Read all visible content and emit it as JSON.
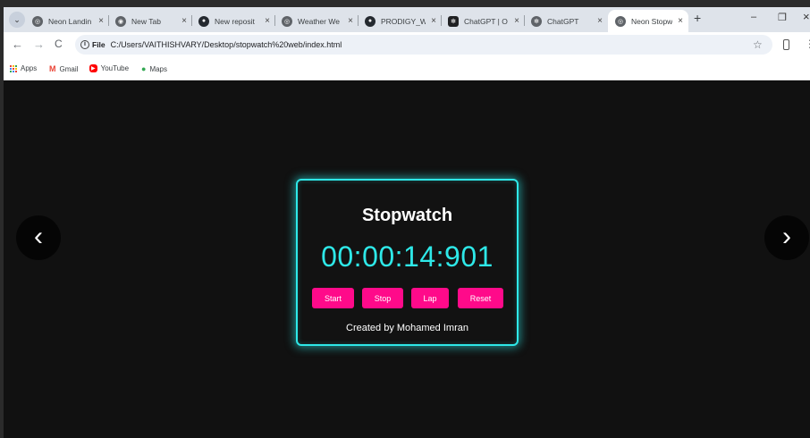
{
  "browser": {
    "tabs": [
      {
        "title": "Neon Landin",
        "icon": "globe-icon"
      },
      {
        "title": "New Tab",
        "icon": "chrome-icon"
      },
      {
        "title": "New reposit",
        "icon": "github-icon"
      },
      {
        "title": "Weather We",
        "icon": "globe-icon"
      },
      {
        "title": "PRODIGY_W",
        "icon": "github-icon"
      },
      {
        "title": "ChatGPT | O",
        "icon": "chatgpt-icon"
      },
      {
        "title": "ChatGPT",
        "icon": "chatgpt-icon"
      },
      {
        "title": "Neon Stopw",
        "icon": "globe-icon",
        "active": true
      }
    ],
    "close_glyph": "×",
    "new_tab_glyph": "+",
    "window_controls": {
      "minimize": "–",
      "restore": "❐",
      "close": "×"
    },
    "nav": {
      "back": "←",
      "forward": "→",
      "reload": "C"
    },
    "address": {
      "scheme_chip": "File",
      "url": "C:/Users/VAITHISHVARY/Desktop/stopwatch%20web/index.html"
    },
    "bookmark_star": "☆",
    "menu_glyph": "⋮",
    "bookmarks": [
      {
        "label": "Apps",
        "icon": "apps-grid-icon"
      },
      {
        "label": "Gmail",
        "icon": "gmail-icon",
        "glyph": "M"
      },
      {
        "label": "YouTube",
        "icon": "youtube-icon",
        "glyph": "▶"
      },
      {
        "label": "Maps",
        "icon": "maps-pin-icon",
        "glyph": "●"
      }
    ]
  },
  "page": {
    "prev_arrow": "‹",
    "next_arrow": "›",
    "stopwatch": {
      "title": "Stopwatch",
      "time": "00:00:14:901",
      "buttons": {
        "start": "Start",
        "stop": "Stop",
        "lap": "Lap",
        "reset": "Reset"
      },
      "credit": "Created by Mohamed Imran"
    }
  },
  "colors": {
    "accent_cyan": "#2ee8e8",
    "button_pink": "#ff0a8a",
    "page_background": "#111111"
  }
}
